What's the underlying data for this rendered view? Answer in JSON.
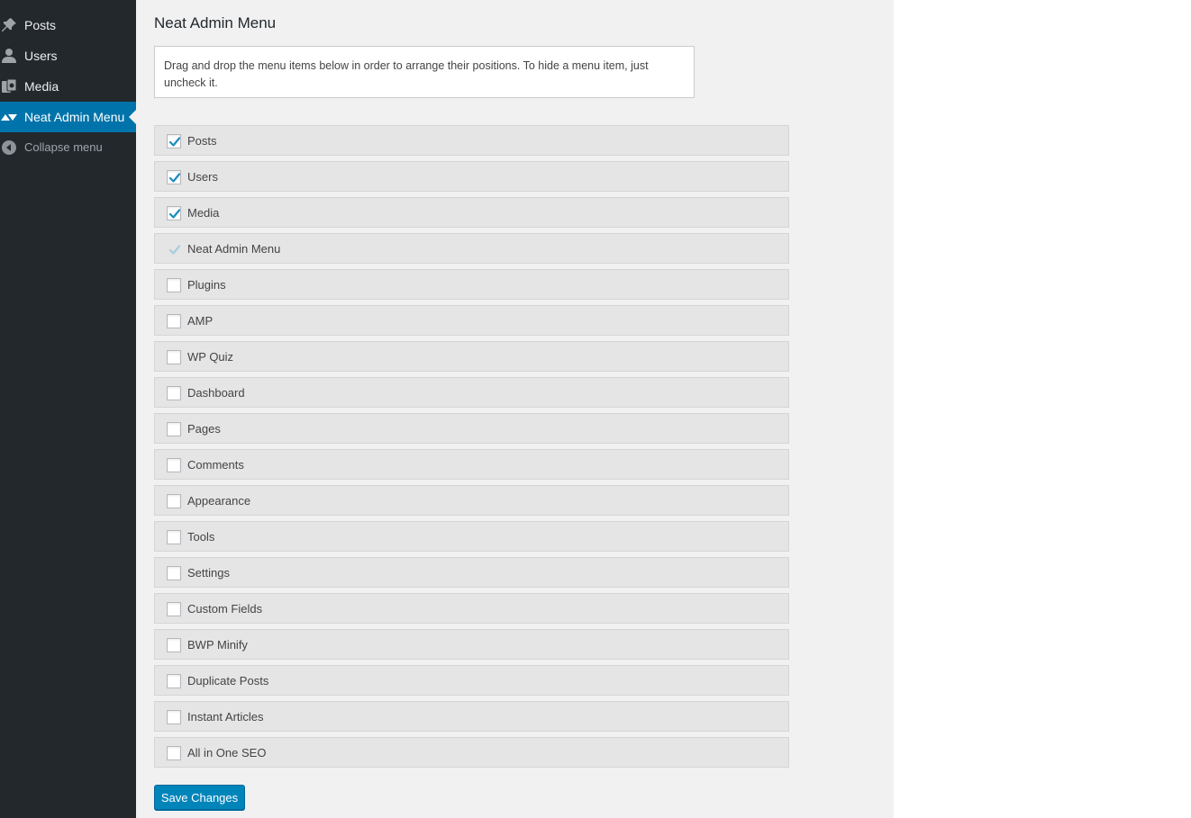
{
  "sidebar": {
    "items": [
      {
        "label": "Posts",
        "icon": "pin-icon",
        "current": false
      },
      {
        "label": "Users",
        "icon": "user-icon",
        "current": false
      },
      {
        "label": "Media",
        "icon": "media-icon",
        "current": false
      },
      {
        "label": "Neat Admin Menu",
        "icon": "sort-icon",
        "current": true
      }
    ],
    "collapse_label": "Collapse menu"
  },
  "page": {
    "title": "Neat Admin Menu",
    "notice": "Drag and drop the menu items below in order to arrange their positions. To hide a menu item, just uncheck it."
  },
  "menu_items": [
    {
      "label": "Posts",
      "checked": true,
      "disabled": false
    },
    {
      "label": "Users",
      "checked": true,
      "disabled": false
    },
    {
      "label": "Media",
      "checked": true,
      "disabled": false
    },
    {
      "label": "Neat Admin Menu",
      "checked": true,
      "disabled": true
    },
    {
      "label": "Plugins",
      "checked": false,
      "disabled": false
    },
    {
      "label": "AMP",
      "checked": false,
      "disabled": false
    },
    {
      "label": "WP Quiz",
      "checked": false,
      "disabled": false
    },
    {
      "label": "Dashboard",
      "checked": false,
      "disabled": false
    },
    {
      "label": "Pages",
      "checked": false,
      "disabled": false
    },
    {
      "label": "Comments",
      "checked": false,
      "disabled": false
    },
    {
      "label": "Appearance",
      "checked": false,
      "disabled": false
    },
    {
      "label": "Tools",
      "checked": false,
      "disabled": false
    },
    {
      "label": "Settings",
      "checked": false,
      "disabled": false
    },
    {
      "label": "Custom Fields",
      "checked": false,
      "disabled": false
    },
    {
      "label": "BWP Minify",
      "checked": false,
      "disabled": false
    },
    {
      "label": "Duplicate Posts",
      "checked": false,
      "disabled": false
    },
    {
      "label": "Instant Articles",
      "checked": false,
      "disabled": false
    },
    {
      "label": "All in One SEO",
      "checked": false,
      "disabled": false
    }
  ],
  "save_label": "Save Changes",
  "colors": {
    "sidebar_bg": "#23282d",
    "accent": "#0073aa",
    "button": "#0085ba",
    "check": "#1e8cbe"
  }
}
